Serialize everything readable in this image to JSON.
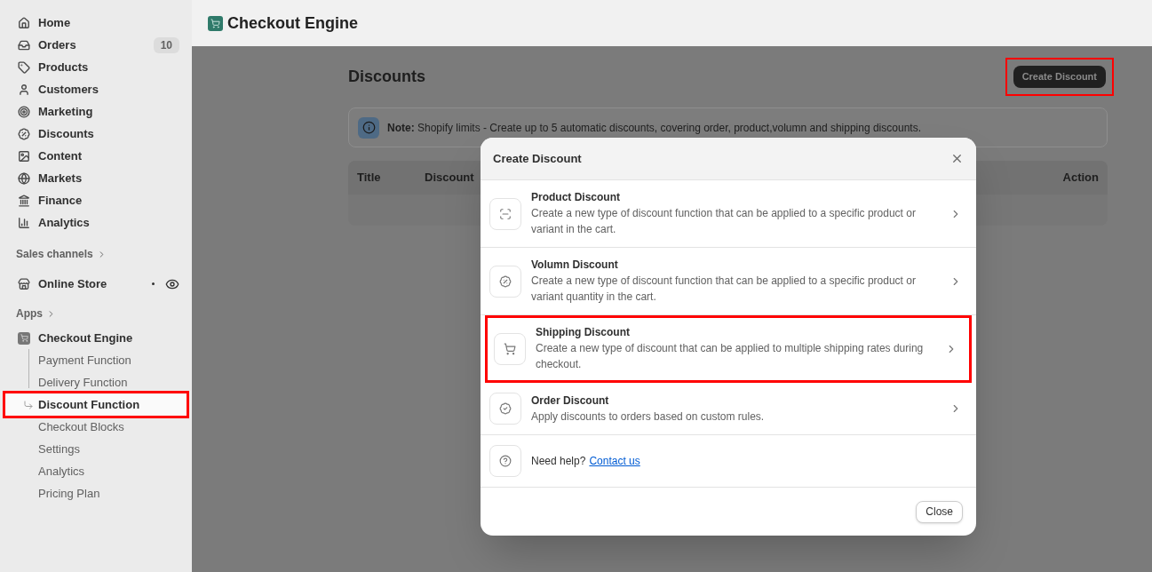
{
  "sidebar": {
    "items": [
      {
        "label": "Home"
      },
      {
        "label": "Orders",
        "badge": "10"
      },
      {
        "label": "Products"
      },
      {
        "label": "Customers"
      },
      {
        "label": "Marketing"
      },
      {
        "label": "Discounts"
      },
      {
        "label": "Content"
      },
      {
        "label": "Markets"
      },
      {
        "label": "Finance"
      },
      {
        "label": "Analytics"
      }
    ],
    "sales_channels": {
      "heading": "Sales channels",
      "items": [
        {
          "label": "Online Store"
        }
      ]
    },
    "apps": {
      "heading": "Apps",
      "app": {
        "label": "Checkout Engine",
        "children": [
          {
            "label": "Payment Function",
            "selected": false,
            "highlighted": false
          },
          {
            "label": "Delivery Function",
            "selected": false,
            "highlighted": false
          },
          {
            "label": "Discount Function",
            "selected": true,
            "highlighted": true
          },
          {
            "label": "Checkout Blocks",
            "selected": false,
            "highlighted": false
          },
          {
            "label": "Settings",
            "selected": false,
            "highlighted": false
          },
          {
            "label": "Analytics",
            "selected": false,
            "highlighted": false
          },
          {
            "label": "Pricing Plan",
            "selected": false,
            "highlighted": false
          }
        ]
      }
    }
  },
  "header": {
    "title": "Checkout Engine"
  },
  "page": {
    "title": "Discounts",
    "create_button": {
      "label": "Create Discount",
      "highlighted": true
    },
    "note": {
      "text": "**Note:** Shopify limits - Create up to 5 automatic discounts, covering order, product,volumn and shipping discounts."
    },
    "table": {
      "columns": [
        "Title",
        "Discount",
        "Action"
      ]
    }
  },
  "modal": {
    "title": "Create Discount",
    "options": [
      {
        "title": "Product Discount",
        "description": "Create a new type of discount function that can be applied to a specific product or variant in the cart.",
        "highlighted": false
      },
      {
        "title": "Volumn Discount",
        "description": "Create a new type of discount function that can be applied to a specific product or variant quantity in the cart.",
        "highlighted": false
      },
      {
        "title": "Shipping Discount",
        "description": "Create a new type of discount that can be applied to multiple shipping rates during checkout.",
        "highlighted": true
      },
      {
        "title": "Order Discount",
        "description": "Apply discounts to orders based on custom rules.",
        "highlighted": false
      }
    ],
    "help": {
      "text": "Need help?",
      "link": "Contact us"
    },
    "close_button": "Close"
  }
}
